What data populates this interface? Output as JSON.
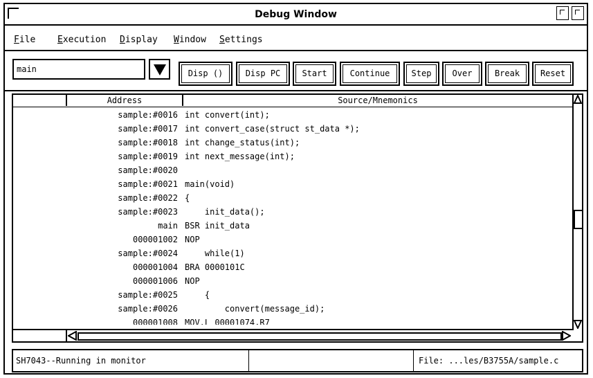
{
  "window": {
    "title": "Debug Window"
  },
  "menu": [
    {
      "label": "File",
      "mnemonic": "F",
      "rest": "ile"
    },
    {
      "label": "Execution",
      "mnemonic": "E",
      "rest": "xecution"
    },
    {
      "label": "Display",
      "mnemonic": "D",
      "rest": "isplay"
    },
    {
      "label": "Window",
      "mnemonic": "W",
      "rest": "indow"
    },
    {
      "label": "Settings",
      "mnemonic": "S",
      "rest": "ettings"
    }
  ],
  "toolbar": {
    "combo_value": "main",
    "buttons": [
      "Disp ()",
      "Disp PC",
      "Start",
      "Continue",
      "Step",
      "Over",
      "Break",
      "Reset"
    ]
  },
  "listing": {
    "headers": {
      "address": "Address",
      "source": "Source/Mnemonics"
    },
    "rows": [
      {
        "addr": "sample:#0016",
        "src": "int convert(int);"
      },
      {
        "addr": "sample:#0017",
        "src": "int convert_case(struct st_data *);"
      },
      {
        "addr": "sample:#0018",
        "src": "int change_status(int);"
      },
      {
        "addr": "sample:#0019",
        "src": "int next_message(int);"
      },
      {
        "addr": "sample:#0020",
        "src": ""
      },
      {
        "addr": "sample:#0021",
        "src": "main(void)"
      },
      {
        "addr": "sample:#0022",
        "src": "{"
      },
      {
        "addr": "sample:#0023",
        "src": "    init_data();"
      },
      {
        "addr": "main",
        "src": "BSR init_data"
      },
      {
        "addr": "000001002",
        "src": "NOP"
      },
      {
        "addr": "sample:#0024",
        "src": "    while(1)"
      },
      {
        "addr": "000001004",
        "src": "BRA 0000101C"
      },
      {
        "addr": "000001006",
        "src": "NOP"
      },
      {
        "addr": "sample:#0025",
        "src": "    {"
      },
      {
        "addr": "sample:#0026",
        "src": "        convert(message_id);"
      },
      {
        "addr": "000001008",
        "src": "MOV.L 00001074,R7"
      }
    ]
  },
  "status": {
    "left": "SH7043--Running in monitor",
    "middle": "",
    "right": "File: ...les/B3755A/sample.c"
  }
}
